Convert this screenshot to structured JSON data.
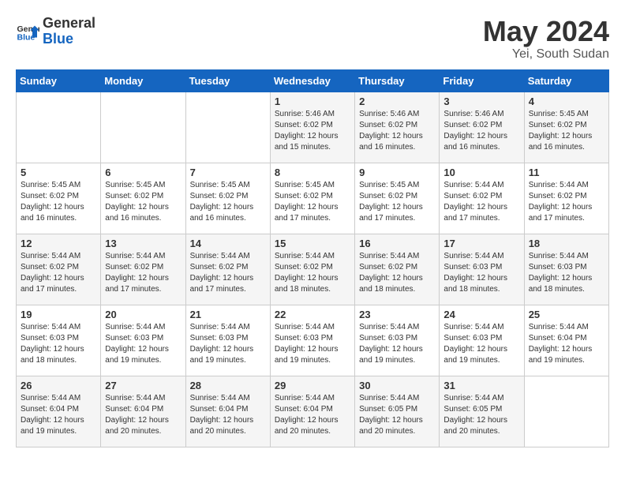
{
  "header": {
    "logo_general": "General",
    "logo_blue": "Blue",
    "month_year": "May 2024",
    "location": "Yei, South Sudan"
  },
  "weekdays": [
    "Sunday",
    "Monday",
    "Tuesday",
    "Wednesday",
    "Thursday",
    "Friday",
    "Saturday"
  ],
  "weeks": [
    [
      {
        "day": "",
        "info": ""
      },
      {
        "day": "",
        "info": ""
      },
      {
        "day": "",
        "info": ""
      },
      {
        "day": "1",
        "info": "Sunrise: 5:46 AM\nSunset: 6:02 PM\nDaylight: 12 hours\nand 15 minutes."
      },
      {
        "day": "2",
        "info": "Sunrise: 5:46 AM\nSunset: 6:02 PM\nDaylight: 12 hours\nand 16 minutes."
      },
      {
        "day": "3",
        "info": "Sunrise: 5:46 AM\nSunset: 6:02 PM\nDaylight: 12 hours\nand 16 minutes."
      },
      {
        "day": "4",
        "info": "Sunrise: 5:45 AM\nSunset: 6:02 PM\nDaylight: 12 hours\nand 16 minutes."
      }
    ],
    [
      {
        "day": "5",
        "info": "Sunrise: 5:45 AM\nSunset: 6:02 PM\nDaylight: 12 hours\nand 16 minutes."
      },
      {
        "day": "6",
        "info": "Sunrise: 5:45 AM\nSunset: 6:02 PM\nDaylight: 12 hours\nand 16 minutes."
      },
      {
        "day": "7",
        "info": "Sunrise: 5:45 AM\nSunset: 6:02 PM\nDaylight: 12 hours\nand 16 minutes."
      },
      {
        "day": "8",
        "info": "Sunrise: 5:45 AM\nSunset: 6:02 PM\nDaylight: 12 hours\nand 17 minutes."
      },
      {
        "day": "9",
        "info": "Sunrise: 5:45 AM\nSunset: 6:02 PM\nDaylight: 12 hours\nand 17 minutes."
      },
      {
        "day": "10",
        "info": "Sunrise: 5:44 AM\nSunset: 6:02 PM\nDaylight: 12 hours\nand 17 minutes."
      },
      {
        "day": "11",
        "info": "Sunrise: 5:44 AM\nSunset: 6:02 PM\nDaylight: 12 hours\nand 17 minutes."
      }
    ],
    [
      {
        "day": "12",
        "info": "Sunrise: 5:44 AM\nSunset: 6:02 PM\nDaylight: 12 hours\nand 17 minutes."
      },
      {
        "day": "13",
        "info": "Sunrise: 5:44 AM\nSunset: 6:02 PM\nDaylight: 12 hours\nand 17 minutes."
      },
      {
        "day": "14",
        "info": "Sunrise: 5:44 AM\nSunset: 6:02 PM\nDaylight: 12 hours\nand 17 minutes."
      },
      {
        "day": "15",
        "info": "Sunrise: 5:44 AM\nSunset: 6:02 PM\nDaylight: 12 hours\nand 18 minutes."
      },
      {
        "day": "16",
        "info": "Sunrise: 5:44 AM\nSunset: 6:02 PM\nDaylight: 12 hours\nand 18 minutes."
      },
      {
        "day": "17",
        "info": "Sunrise: 5:44 AM\nSunset: 6:03 PM\nDaylight: 12 hours\nand 18 minutes."
      },
      {
        "day": "18",
        "info": "Sunrise: 5:44 AM\nSunset: 6:03 PM\nDaylight: 12 hours\nand 18 minutes."
      }
    ],
    [
      {
        "day": "19",
        "info": "Sunrise: 5:44 AM\nSunset: 6:03 PM\nDaylight: 12 hours\nand 18 minutes."
      },
      {
        "day": "20",
        "info": "Sunrise: 5:44 AM\nSunset: 6:03 PM\nDaylight: 12 hours\nand 19 minutes."
      },
      {
        "day": "21",
        "info": "Sunrise: 5:44 AM\nSunset: 6:03 PM\nDaylight: 12 hours\nand 19 minutes."
      },
      {
        "day": "22",
        "info": "Sunrise: 5:44 AM\nSunset: 6:03 PM\nDaylight: 12 hours\nand 19 minutes."
      },
      {
        "day": "23",
        "info": "Sunrise: 5:44 AM\nSunset: 6:03 PM\nDaylight: 12 hours\nand 19 minutes."
      },
      {
        "day": "24",
        "info": "Sunrise: 5:44 AM\nSunset: 6:03 PM\nDaylight: 12 hours\nand 19 minutes."
      },
      {
        "day": "25",
        "info": "Sunrise: 5:44 AM\nSunset: 6:04 PM\nDaylight: 12 hours\nand 19 minutes."
      }
    ],
    [
      {
        "day": "26",
        "info": "Sunrise: 5:44 AM\nSunset: 6:04 PM\nDaylight: 12 hours\nand 19 minutes."
      },
      {
        "day": "27",
        "info": "Sunrise: 5:44 AM\nSunset: 6:04 PM\nDaylight: 12 hours\nand 20 minutes."
      },
      {
        "day": "28",
        "info": "Sunrise: 5:44 AM\nSunset: 6:04 PM\nDaylight: 12 hours\nand 20 minutes."
      },
      {
        "day": "29",
        "info": "Sunrise: 5:44 AM\nSunset: 6:04 PM\nDaylight: 12 hours\nand 20 minutes."
      },
      {
        "day": "30",
        "info": "Sunrise: 5:44 AM\nSunset: 6:05 PM\nDaylight: 12 hours\nand 20 minutes."
      },
      {
        "day": "31",
        "info": "Sunrise: 5:44 AM\nSunset: 6:05 PM\nDaylight: 12 hours\nand 20 minutes."
      },
      {
        "day": "",
        "info": ""
      }
    ]
  ]
}
